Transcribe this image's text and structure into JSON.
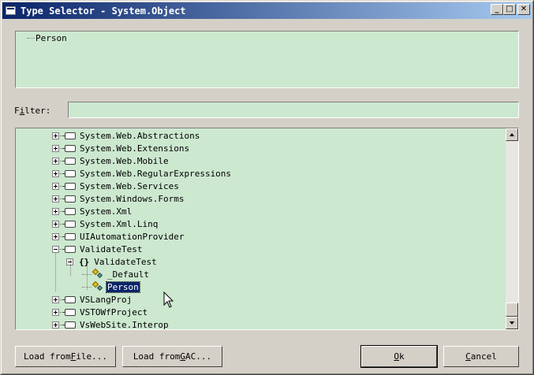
{
  "window": {
    "title": "Type Selector - System.Object",
    "controls": [
      "minimize",
      "maximize",
      "close"
    ]
  },
  "selected_type": {
    "label": "Person"
  },
  "filter": {
    "label_pre": "F",
    "label_mnemonic": "i",
    "label_post": "lter:",
    "value": ""
  },
  "tree": {
    "assemblies_top": [
      "System.Web.Abstractions",
      "System.Web.Extensions",
      "System.Web.Mobile",
      "System.Web.RegularExpressions",
      "System.Web.Services",
      "System.Windows.Forms",
      "System.Xml",
      "System.Xml.Linq",
      "UIAutomationProvider"
    ],
    "expanded_assembly": "ValidateTest",
    "namespace": "ValidateTest",
    "classes": [
      "_Default",
      "Person"
    ],
    "selected_class": "Person",
    "assemblies_bottom": [
      "VSLangProj",
      "VSTOWfProject",
      "VsWebSite.Interop"
    ]
  },
  "buttons": {
    "load_file_pre": "Load from ",
    "load_file_mnemonic": "F",
    "load_file_post": "ile...",
    "load_gac_pre": "Load from ",
    "load_gac_mnemonic": "G",
    "load_gac_post": "AC...",
    "ok_mnemonic": "O",
    "ok_post": "k",
    "cancel_mnemonic": "C",
    "cancel_post": "ancel"
  },
  "colors": {
    "panel_bg": "#cce8cf",
    "titlebar_start": "#0a246a",
    "titlebar_end": "#a6caf0",
    "selection": "#0a246a"
  }
}
